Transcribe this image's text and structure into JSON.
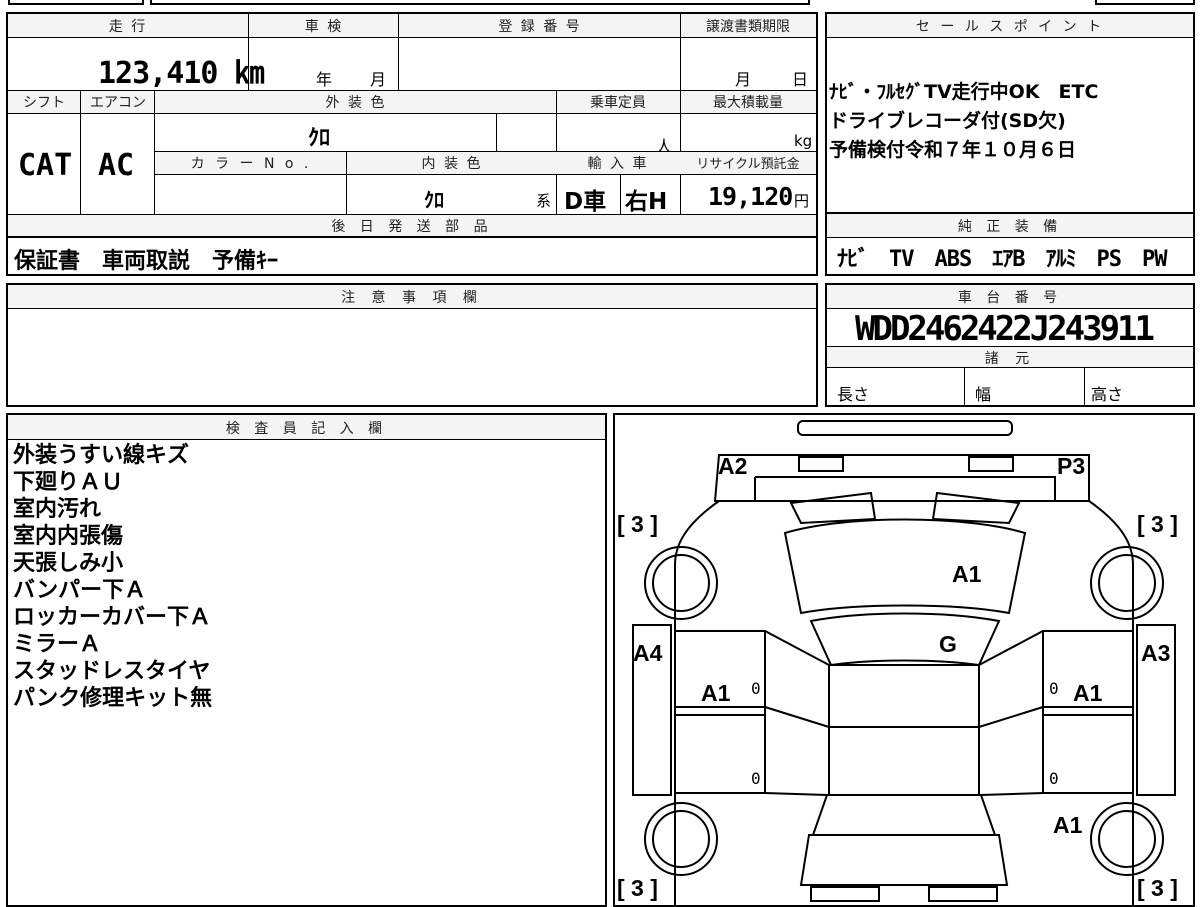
{
  "labels": {
    "mileage": "走 行",
    "inspection": "車 検",
    "reg_number": "登 録 番 号",
    "transfer_deadline": "譲渡書類期限",
    "sales_point": "セ ー ル ス ポ イ ン ト",
    "shift": "シフト",
    "aircon": "エアコン",
    "ext_color": "外 装 色",
    "capacity": "乗車定員",
    "max_load": "最大積載量",
    "color_no": "カ ラ ー N o .",
    "int_color": "内 装 色",
    "import": "輸 入 車",
    "recycle": "リサイクル預託金",
    "later_parts": "後 日 発 送 部 品",
    "genuine_equipment": "純 正 装 備",
    "caution": "注 意 事 項 欄",
    "chassis": "車 台 番 号",
    "specs": "諸 元",
    "inspector": "検 査 員 記 入 欄"
  },
  "units": {
    "year": "年",
    "month": "月",
    "month2": "月",
    "day": "日",
    "person": "人",
    "kg": "kg",
    "kei": "系",
    "yen": "円"
  },
  "values": {
    "mileage": "123,410 ㎞",
    "shift": "CAT",
    "aircon": "AC",
    "ext_color": "ｸﾛ",
    "int_color": "ｸﾛ",
    "import_type": "D車",
    "handle": "右H",
    "recycle_fee": "19,120",
    "later_parts": "保証書　車両取説　予備ｷｰ",
    "equipment": "ﾅﾋﾞ　TV　ABS　ｴｱB　ｱﾙﾐ　PS　PW",
    "chassis": "WDD2462422J243911"
  },
  "sales_points": [
    "ﾅﾋﾞ・ﾌﾙｾｸﾞTV走行中OK　ETC",
    "ドライブレコーダ付(SD欠)",
    "予備検付令和７年１０月６日"
  ],
  "specs": {
    "length": "長さ",
    "width": "幅",
    "height": "高さ"
  },
  "inspector_notes": [
    "外装うすい線キズ",
    "下廻りＡＵ",
    "室内汚れ",
    "室内内張傷",
    "天張しみ小",
    "バンパー下Ａ",
    "ロッカーカバー下Ａ",
    "ミラーＡ",
    "スタッドレスタイヤ",
    "パンク修理キット無"
  ],
  "diagram": {
    "marks": {
      "front_left": "A2",
      "front_right": "P3",
      "hood": "A1",
      "windshield": "G",
      "left_fender": "A4",
      "right_fender": "A3",
      "left_front_door": "A1",
      "right_front_door": "A1",
      "right_rear": "A1"
    },
    "tire_tl": "[ 3 ]",
    "tire_tr": "[ 3 ]",
    "tire_bl": "[ 3 ]",
    "tire_br": "[ 3 ]",
    "zero": "0"
  }
}
